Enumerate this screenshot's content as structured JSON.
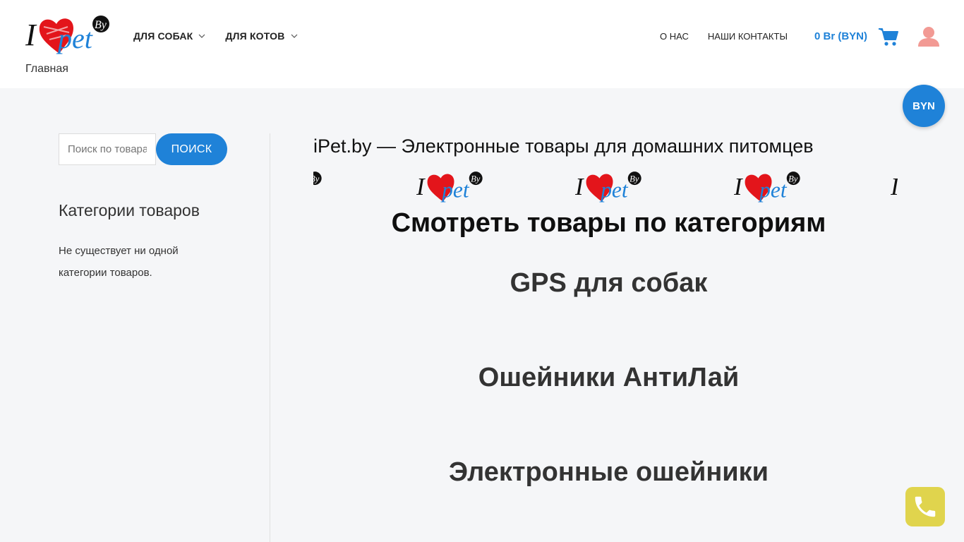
{
  "header": {
    "logo_text": "Главная",
    "nav_left": [
      {
        "label": "ДЛЯ СОБАК"
      },
      {
        "label": "ДЛЯ КОТОВ"
      }
    ],
    "nav_right": [
      {
        "label": "О НАС"
      },
      {
        "label": "НАШИ КОНТАКТЫ"
      }
    ],
    "cart_total": "0 Br (BYN)",
    "icons": {
      "cart": "cart-icon",
      "user": "user-icon",
      "dropdown": "chevron-down-icon"
    },
    "colors": {
      "accent": "#1f82d8",
      "user": "#f29a94",
      "heart": "#e3151b"
    }
  },
  "currency_badge": "BYN",
  "sidebar": {
    "search_placeholder": "Поиск по товарам",
    "search_button": "ПОИСК",
    "categories_title": "Категории товаров",
    "categories_empty": "Не существует ни одной категории товаров."
  },
  "main": {
    "title": "iPet.by — Электронные товары для домашних питомцев",
    "section_title": "Смотреть товары по категориям",
    "categories": [
      {
        "label": "GPS для собак"
      },
      {
        "label": "Ошейники АнтиЛай"
      },
      {
        "label": "Электронные ошейники"
      }
    ]
  },
  "phone_button": {
    "icon": "phone-icon",
    "color": "#e0d44d"
  }
}
